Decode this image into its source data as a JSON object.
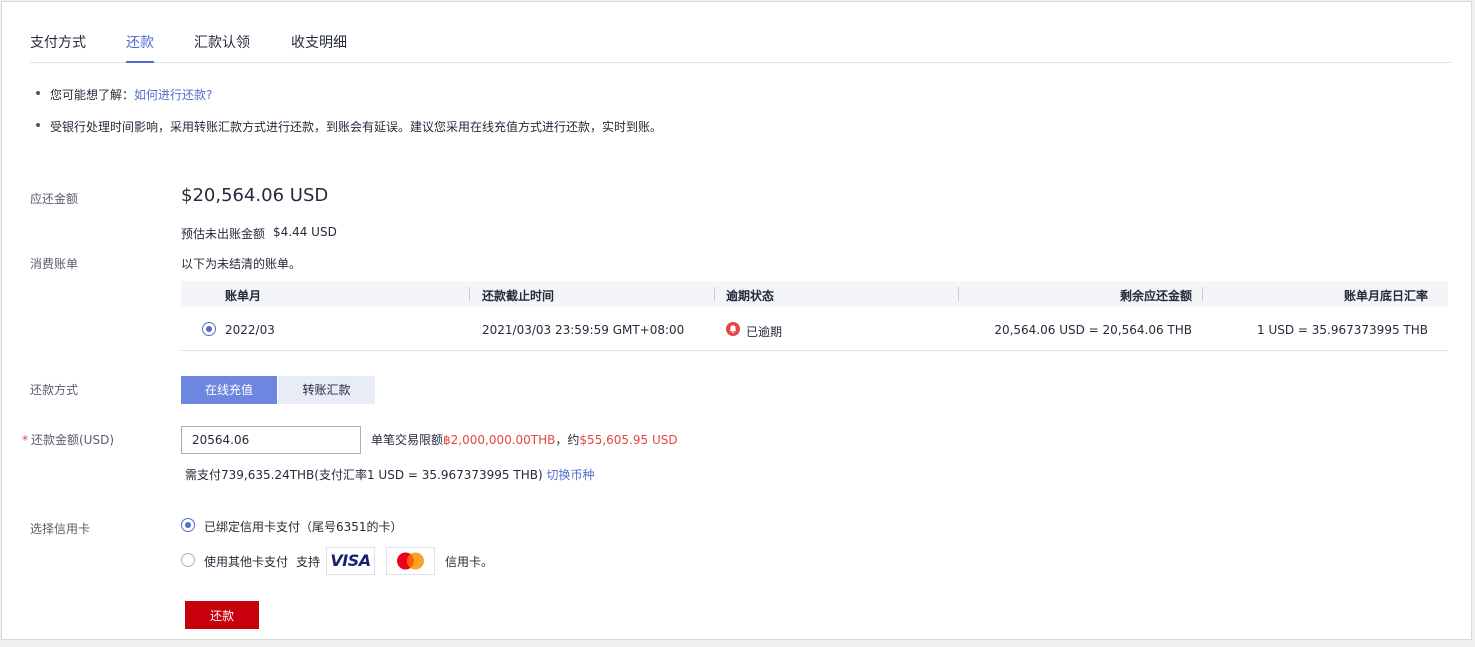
{
  "tabs": [
    "支付方式",
    "还款",
    "汇款认领",
    "收支明细"
  ],
  "notes": {
    "hint_prefix": "您可能想了解：",
    "hint_link": "如何进行还款?",
    "delay_notice": "受银行处理时间影响，采用转账汇款方式进行还款，到账会有延误。建议您采用在线充值方式进行还款，实时到账。"
  },
  "repayment": {
    "amount_label": "应还金额",
    "amount": "$20,564.06 USD",
    "estimate_label": "预估未出账金额",
    "estimate_value": "$4.44 USD"
  },
  "bills": {
    "label": "消费账单",
    "description": "以下为未结清的账单。",
    "columns": [
      "账单月",
      "还款截止时间",
      "逾期状态",
      "剩余应还金额",
      "账单月底日汇率"
    ],
    "rows": [
      {
        "month": "2022/03",
        "deadline": "2021/03/03 23:59:59 GMT+08:00",
        "status": "已逾期",
        "remaining": "20,564.06 USD = 20,564.06 THB",
        "rate": "1 USD = 35.967373995 THB"
      }
    ]
  },
  "method": {
    "label": "还款方式",
    "options": [
      "在线充值",
      "转账汇款"
    ]
  },
  "amount_input": {
    "required_mark": "*",
    "label": "还款金额(USD)",
    "value": "20564.06",
    "limit_prefix": "单笔交易限额",
    "limit_thb": "฿2,000,000.00THB",
    "limit_mid": "，约",
    "limit_usd": "$55,605.95 USD",
    "payable_text": "需支付739,635.24THB(支付汇率1 USD = 35.967373995 THB)",
    "switch_currency": "切换币种"
  },
  "credit_card": {
    "label": "选择信用卡",
    "bound_option": "已绑定信用卡支付（尾号6351的卡）",
    "other_option": "使用其他卡支付",
    "support_prefix": "支持",
    "visa_text": "VISA",
    "support_suffix": "信用卡。"
  },
  "submit_label": "还款",
  "colors": {
    "accent": "#526ecc",
    "submit": "#c7000b",
    "danger": "#e54545",
    "mastercard_red": "#eb001b",
    "mastercard_orange": "#f79e1b"
  }
}
